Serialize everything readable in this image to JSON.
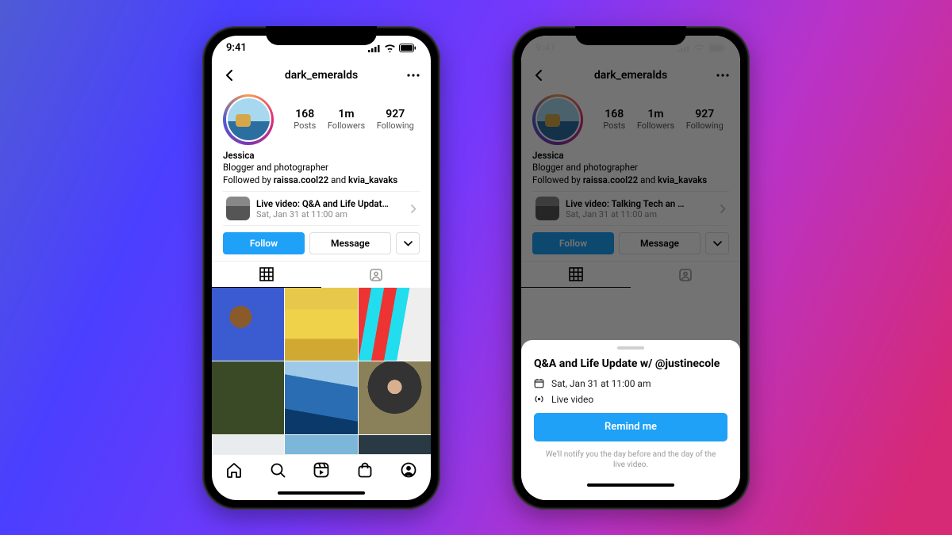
{
  "status": {
    "time": "9:41"
  },
  "profile": {
    "username": "dark_emeralds",
    "stats": {
      "posts": {
        "count": "168",
        "label": "Posts"
      },
      "followers": {
        "count": "1m",
        "label": "Followers"
      },
      "following": {
        "count": "927",
        "label": "Following"
      }
    },
    "bio": {
      "name": "Jessica",
      "line1": "Blogger and photographer",
      "followed_prefix": "Followed by ",
      "followed_1": "raissa.cool22",
      "followed_mid": " and ",
      "followed_2": "kvia_kavaks"
    },
    "live_a": {
      "title": "Live video: Q&A and Life Updat…",
      "date": "Sat, Jan 31 at 11:00 am"
    },
    "live_b": {
      "title": "Live video: Talking Tech an …",
      "date": "Sat, Jan 31 at 11:00 am"
    },
    "buttons": {
      "follow": "Follow",
      "message": "Message"
    }
  },
  "sheet": {
    "title": "Q&A and Life Update w/ @justinecole",
    "date": "Sat, Jan 31 at 11:00 am",
    "type": "Live video",
    "cta": "Remind me",
    "foot": "We'll notify you the day before and the day of the live video."
  }
}
